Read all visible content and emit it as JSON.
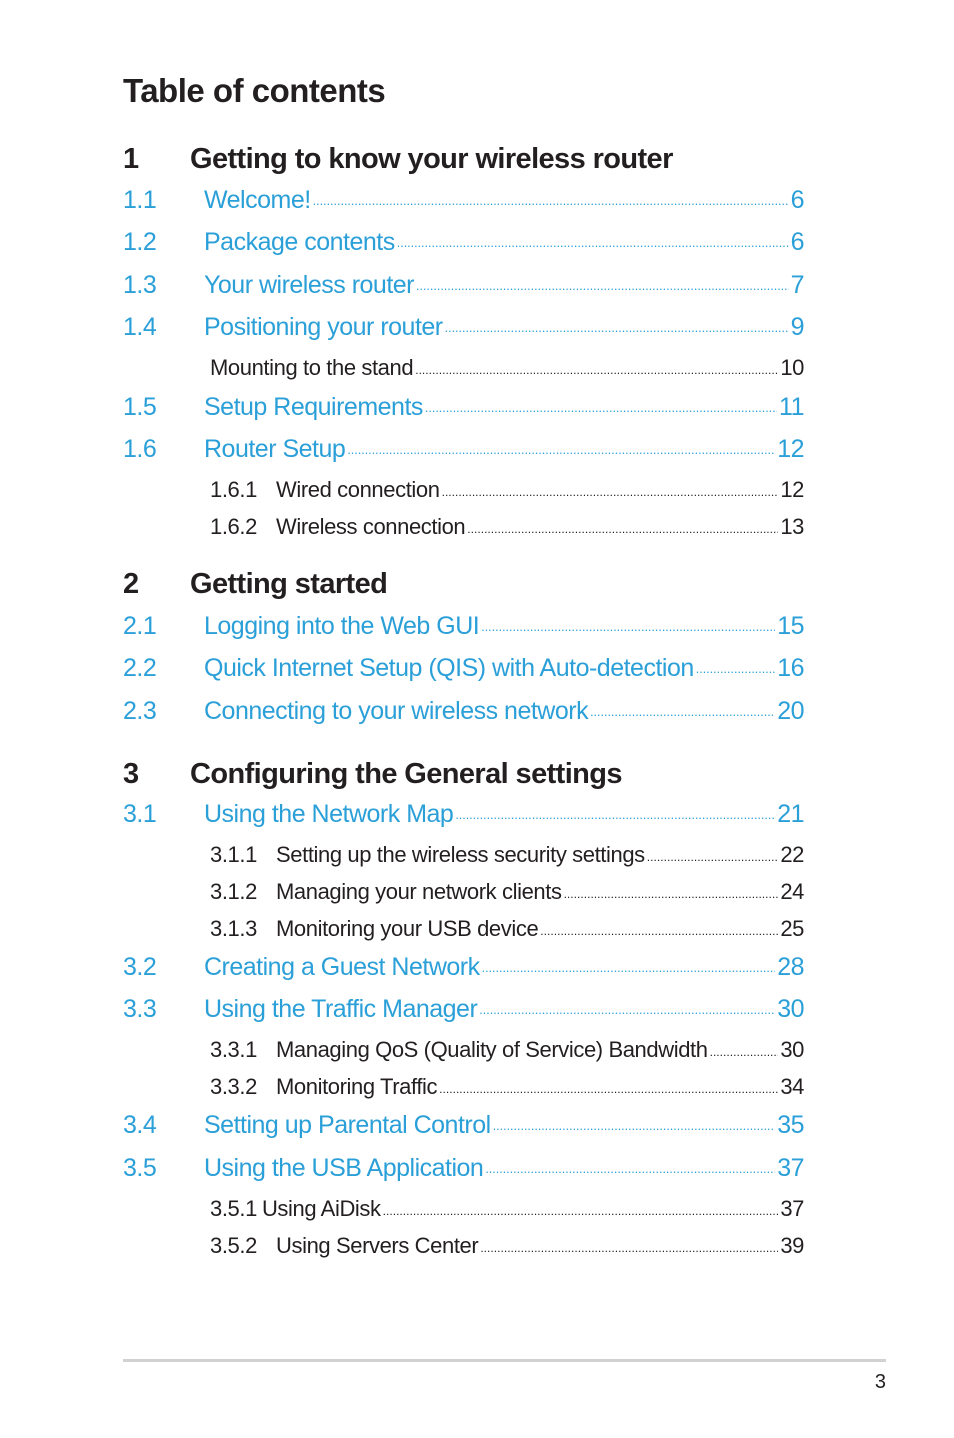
{
  "title": "Table of contents",
  "chapters": [
    {
      "num": "1",
      "title": "Getting to know your wireless router",
      "entries": [
        {
          "level": 2,
          "num": "1.1",
          "label": "Welcome!",
          "page": "6"
        },
        {
          "level": 2,
          "num": "1.2",
          "label": "Package contents",
          "page": "6"
        },
        {
          "level": 2,
          "num": "1.3",
          "label": "Your wireless router",
          "page": "7"
        },
        {
          "level": 2,
          "num": "1.4",
          "label": "Positioning your router",
          "page": "9"
        },
        {
          "level": 3,
          "num": "",
          "label": "Mounting to the stand",
          "page": "10"
        },
        {
          "level": 2,
          "num": "1.5",
          "label": "Setup Requirements",
          "page": "11"
        },
        {
          "level": 2,
          "num": "1.6",
          "label": "Router Setup",
          "page": "12"
        },
        {
          "level": 3,
          "num": "1.6.1",
          "label": "Wired connection",
          "page": "12"
        },
        {
          "level": 3,
          "num": "1.6.2",
          "label": "Wireless connection",
          "page": "13"
        }
      ]
    },
    {
      "num": "2",
      "title": "Getting started",
      "entries": [
        {
          "level": 2,
          "num": "2.1",
          "label": "Logging into the Web GUI",
          "page": "15"
        },
        {
          "level": 2,
          "num": "2.2",
          "label": "Quick Internet Setup (QIS) with Auto-detection",
          "page": "16"
        },
        {
          "level": 2,
          "num": "2.3",
          "label": "Connecting to your wireless network",
          "page": "20"
        }
      ]
    },
    {
      "num": "3",
      "title": "Configuring the General settings",
      "entries": [
        {
          "level": 2,
          "num": "3.1",
          "label": "Using the Network Map",
          "page": "21"
        },
        {
          "level": 3,
          "num": "3.1.1",
          "label": "Setting up the wireless security settings",
          "page": "22"
        },
        {
          "level": 3,
          "num": "3.1.2",
          "label": "Managing your network clients",
          "page": "24"
        },
        {
          "level": 3,
          "num": "3.1.3",
          "label": "Monitoring your USB device",
          "page": "25"
        },
        {
          "level": 2,
          "num": "3.2",
          "label": "Creating a Guest Network",
          "page": "28"
        },
        {
          "level": 2,
          "num": "3.3",
          "label": "Using the Traffic Manager",
          "page": "30"
        },
        {
          "level": 3,
          "num": "3.3.1",
          "label": "Managing QoS (Quality of Service) Bandwidth",
          "page": "30"
        },
        {
          "level": 3,
          "num": "3.3.2",
          "label": "Monitoring Traffic",
          "page": "34"
        },
        {
          "level": 2,
          "num": "3.4",
          "label": "Setting up Parental Control",
          "page": "35"
        },
        {
          "level": 2,
          "num": "3.5",
          "label": "Using the USB Application",
          "page": "37"
        },
        {
          "level": 3,
          "num": "3.5.1",
          "label": "Using AiDisk",
          "page": "37",
          "tight": true
        },
        {
          "level": 3,
          "num": "3.5.2",
          "label": "Using Servers Center",
          "page": "39"
        }
      ]
    }
  ],
  "footer": {
    "page_number": "3"
  },
  "colors": {
    "link_blue": "#2a9fd8",
    "text": "#231f20",
    "rule": "#d2d2d2"
  }
}
